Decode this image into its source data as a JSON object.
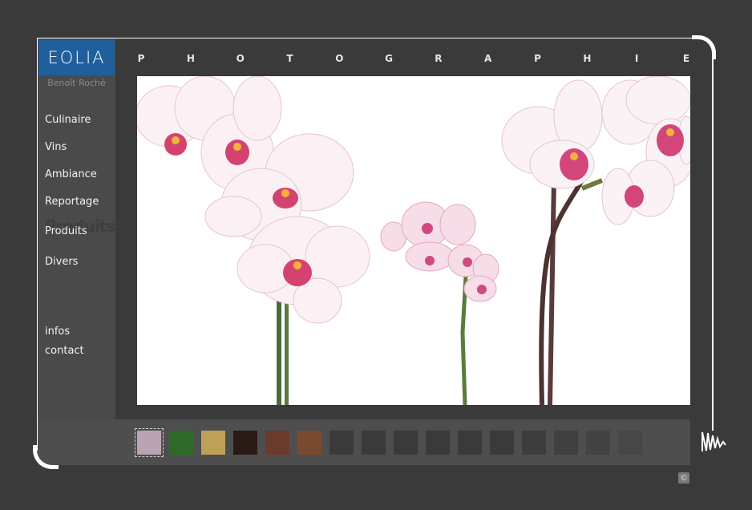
{
  "brand": {
    "logo": "EOLIA",
    "author": "Benoît Roché",
    "accent": "#1f5f9c"
  },
  "header": {
    "title_letters": [
      "P",
      "H",
      "O",
      "T",
      "O",
      "G",
      "R",
      "A",
      "P",
      "H",
      "I",
      "E"
    ]
  },
  "nav": {
    "items": [
      {
        "label": "Culinaire"
      },
      {
        "label": "Vins"
      },
      {
        "label": "Ambiance"
      },
      {
        "label": "Reportage"
      },
      {
        "label": "Produits"
      },
      {
        "label": "Divers"
      }
    ],
    "ghost_label": "Produits",
    "secondary": [
      {
        "label": "infos"
      },
      {
        "label": "contact"
      }
    ]
  },
  "gallery": {
    "main_image": "orchids-photo",
    "thumbnails": [
      {
        "name": "orchid",
        "color": "#b9a5b2",
        "active": true
      },
      {
        "name": "leaves",
        "color": "#2f6a2a"
      },
      {
        "name": "straw",
        "color": "#bfa059"
      },
      {
        "name": "dark-brown",
        "color": "#2a1a16"
      },
      {
        "name": "food",
        "color": "#6b3a2a"
      },
      {
        "name": "table",
        "color": "#7a4a30"
      },
      {
        "name": "empty-1",
        "color": "#3a3a3a"
      },
      {
        "name": "empty-2",
        "color": "#3a3a3a"
      },
      {
        "name": "empty-3",
        "color": "#3a3a3a"
      },
      {
        "name": "empty-4",
        "color": "#3a3a3a"
      },
      {
        "name": "empty-5",
        "color": "#3a3a3a"
      },
      {
        "name": "empty-6",
        "color": "#3a3a3a"
      },
      {
        "name": "empty-7",
        "color": "#3d3d3d"
      },
      {
        "name": "empty-8",
        "color": "#404040"
      },
      {
        "name": "empty-9",
        "color": "#434343"
      },
      {
        "name": "empty-10",
        "color": "#474747"
      }
    ]
  },
  "footer": {
    "copyright_symbol": "©"
  }
}
